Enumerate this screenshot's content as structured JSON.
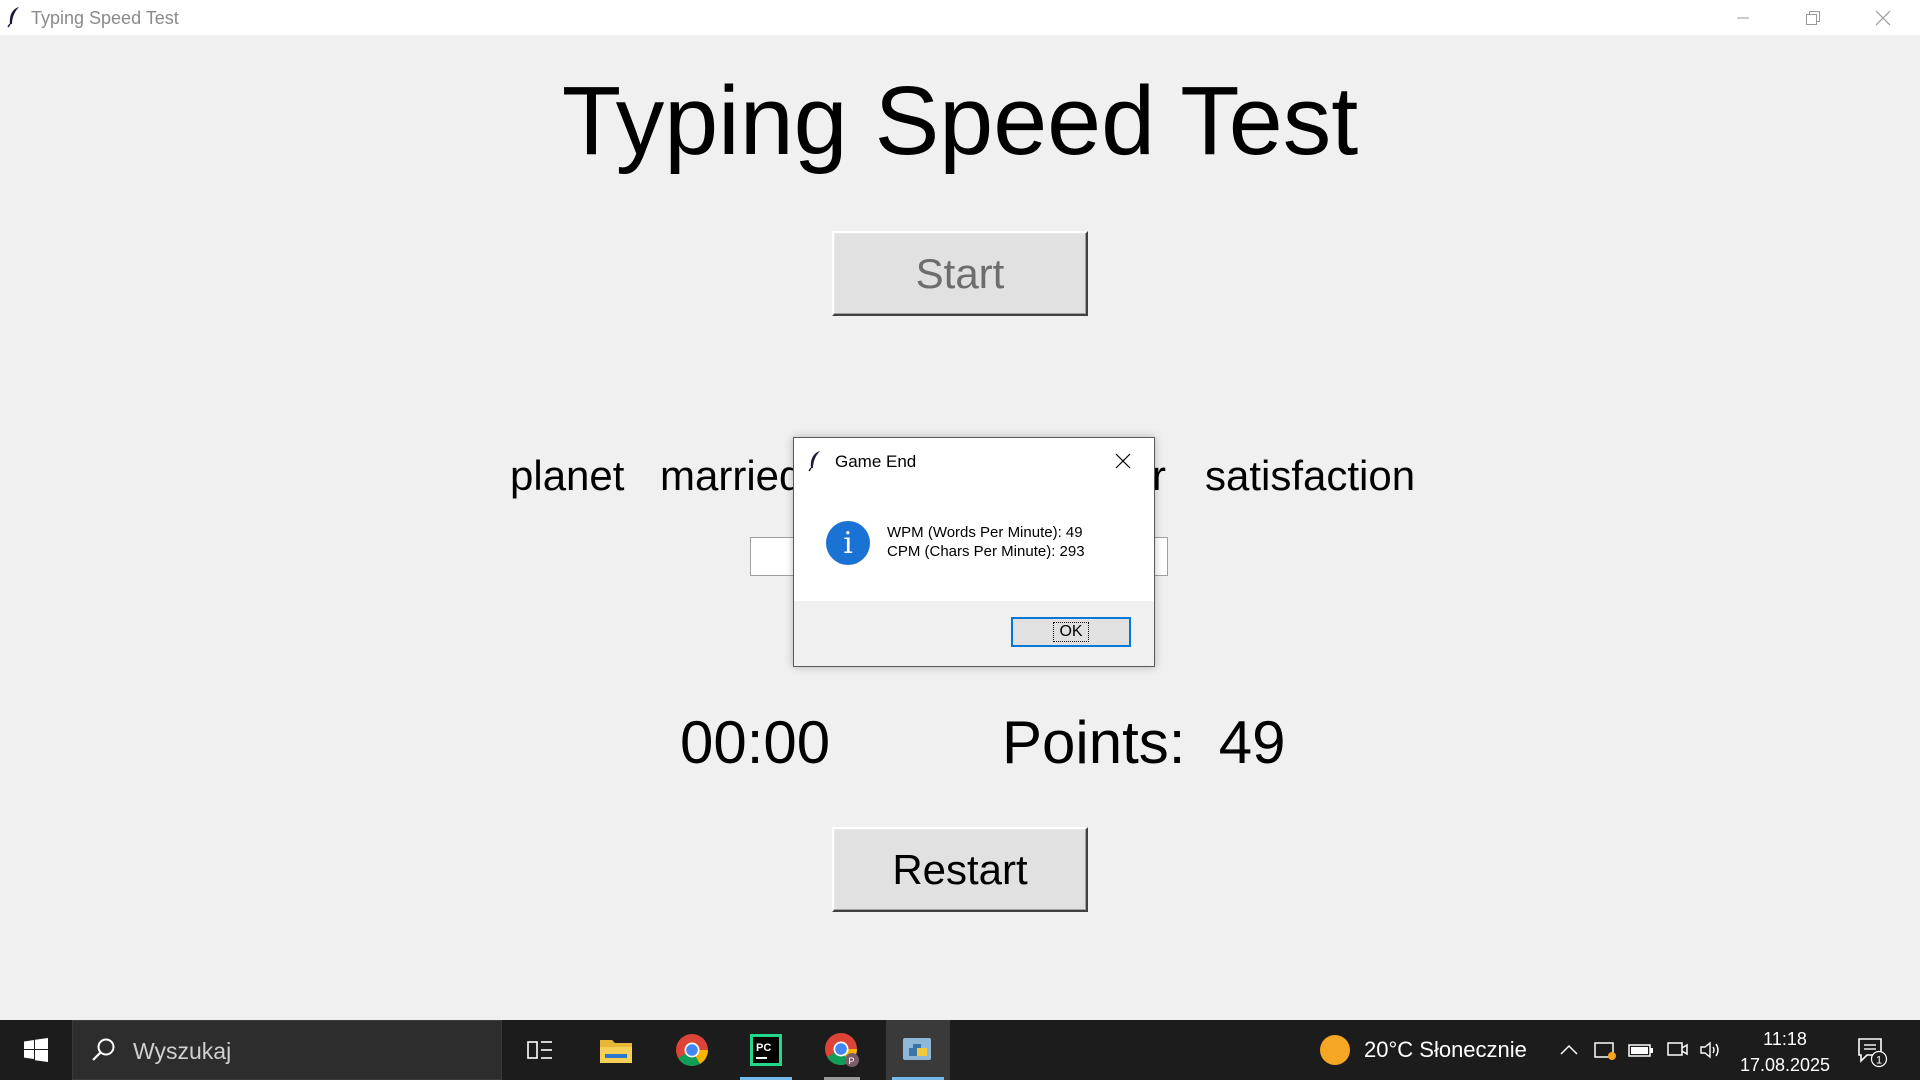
{
  "window": {
    "title": "Typing Speed Test",
    "controls": [
      "minimize",
      "restore",
      "close"
    ]
  },
  "app": {
    "title": "Typing Speed Test",
    "start_label": "Start",
    "words": [
      "planet",
      "married",
      "r",
      "satisfaction"
    ],
    "entry_value": "",
    "timer": "00:00",
    "points_label": "Points:",
    "points_value": "49",
    "restart_label": "Restart"
  },
  "dialog": {
    "title": "Game End",
    "icon": "info-icon",
    "line1": "WPM (Words Per Minute): 49",
    "line2": "CPM (Chars Per Minute): 293",
    "ok_label": "OK"
  },
  "taskbar": {
    "search_placeholder": "Wyszukaj",
    "apps": [
      "task-view",
      "file-explorer",
      "chrome",
      "pycharm",
      "chrome-profile",
      "python"
    ],
    "weather": "20°C  Słonecznie",
    "time": "11:18",
    "date": "17.08.2025",
    "notification_count": "1"
  },
  "colors": {
    "window_bg": "#f0f0f0",
    "taskbar_bg": "#1c1c1c",
    "info_blue": "#1a73d4",
    "accent": "#0078d7"
  }
}
